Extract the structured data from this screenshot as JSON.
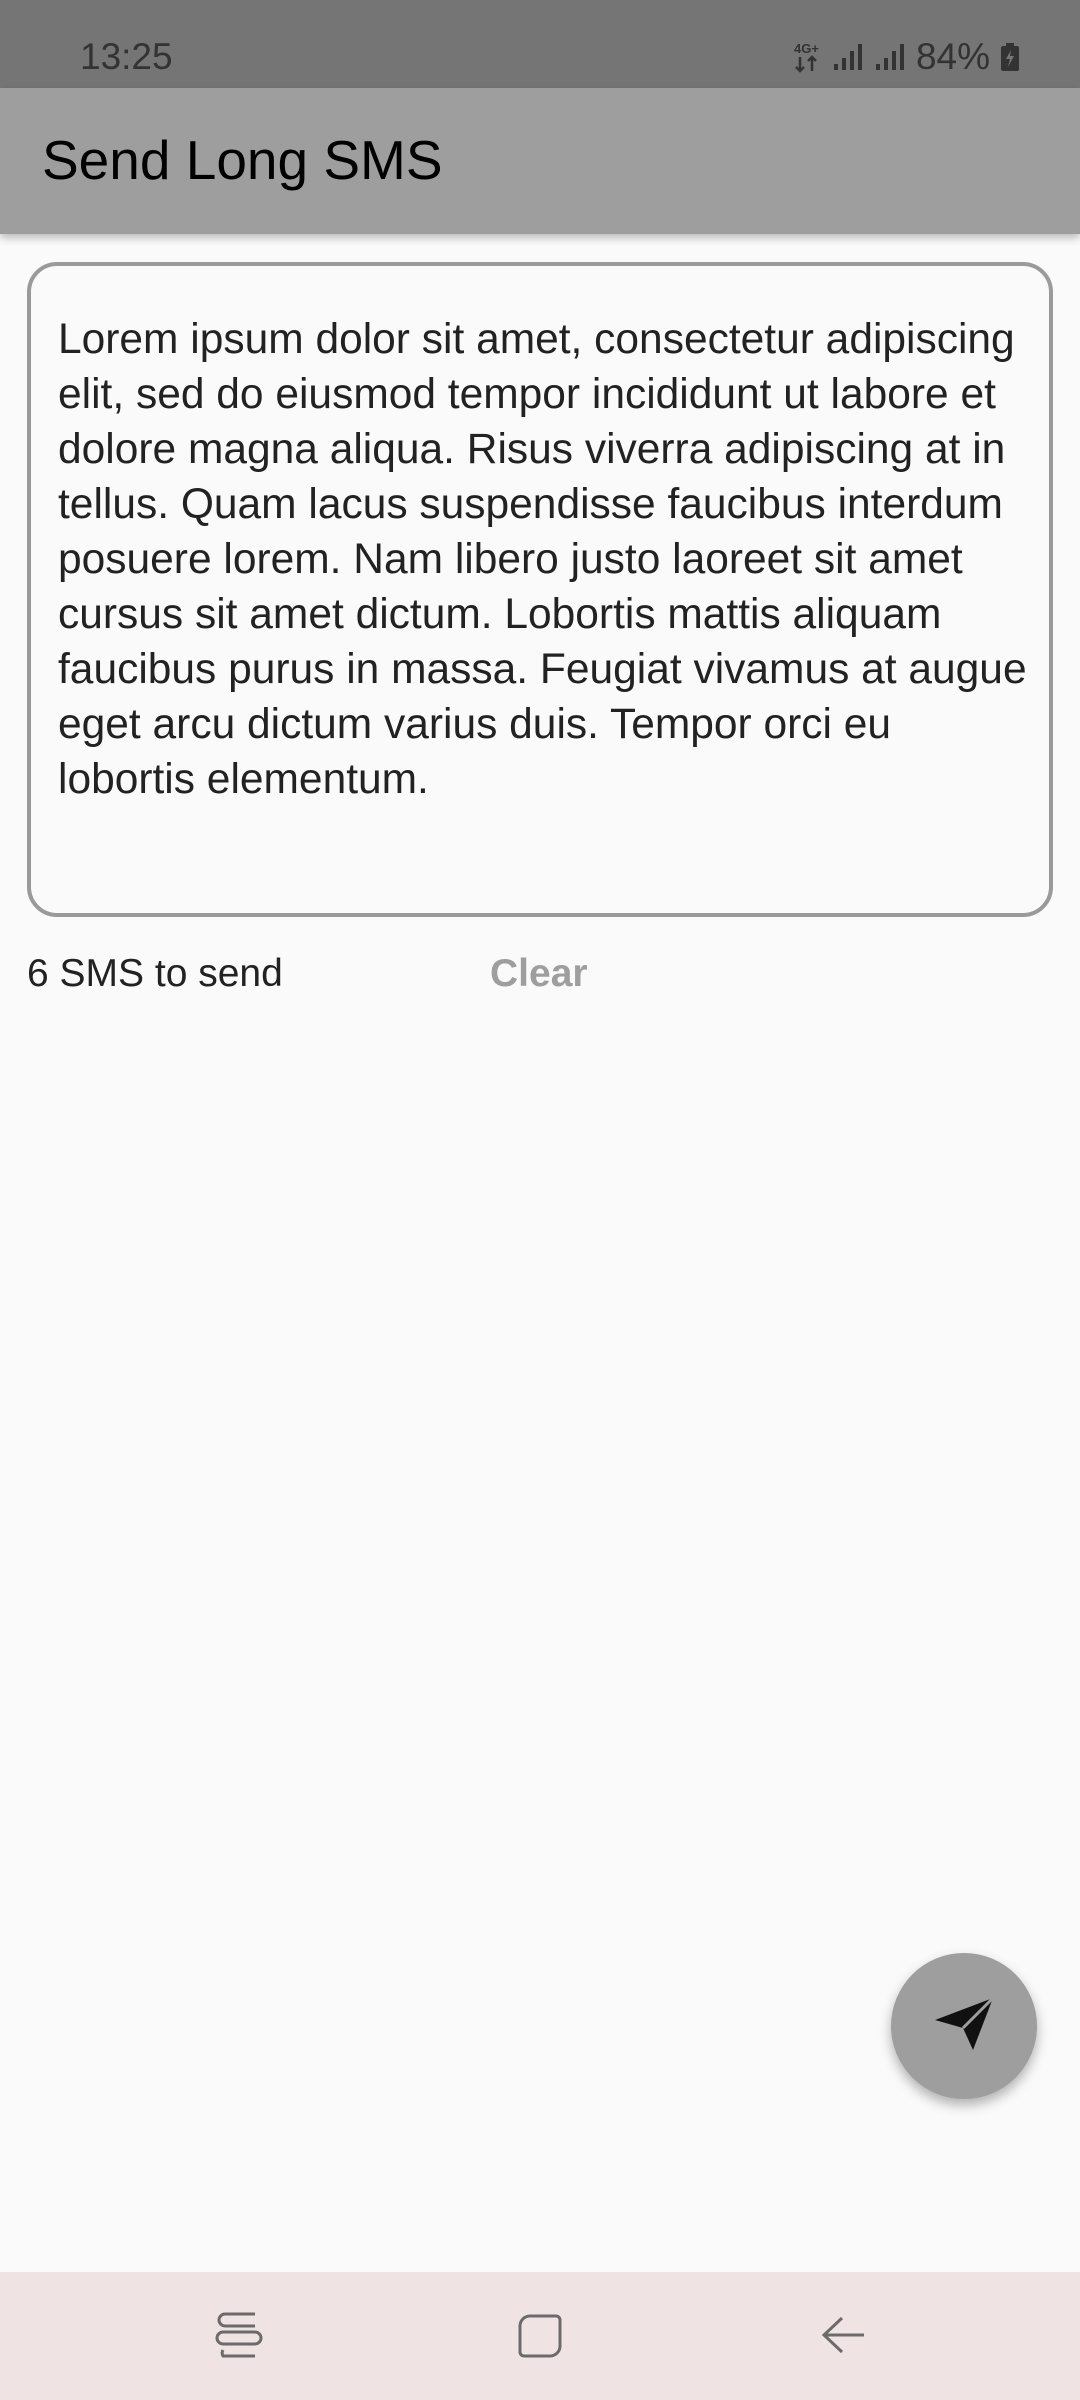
{
  "status_bar": {
    "time": "13:25",
    "network": "4G+",
    "battery": "84%",
    "icons": [
      "data-arrows-icon",
      "signal-icon",
      "signal-icon",
      "battery-charging-icon"
    ]
  },
  "app_bar": {
    "title": "Send Long SMS"
  },
  "message_input": {
    "value": "Lorem ipsum dolor sit amet, consectetur adipiscing elit, sed do eiusmod tempor incididunt ut labore et dolore magna aliqua. Risus viverra adipiscing at in tellus. Quam lacus suspendisse faucibus interdum posuere lorem. Nam libero justo laoreet sit amet cursus sit amet dictum. Lobortis mattis aliquam faucibus purus in massa. Feugiat vivamus at augue eget arcu dictum varius duis. Tempor orci eu lobortis elementum."
  },
  "footer_row": {
    "sms_count_text": "6 SMS to send",
    "clear_label": "Clear"
  },
  "fab": {
    "icon": "send-icon"
  },
  "nav_bar": {
    "items": [
      "recent-apps-icon",
      "home-icon",
      "back-icon"
    ]
  },
  "colors": {
    "status_bar": "#757575",
    "app_bar": "#9e9e9e",
    "background": "#fafafa",
    "nav_bar": "#efe3e4",
    "clear_text": "#9e9e9e"
  }
}
